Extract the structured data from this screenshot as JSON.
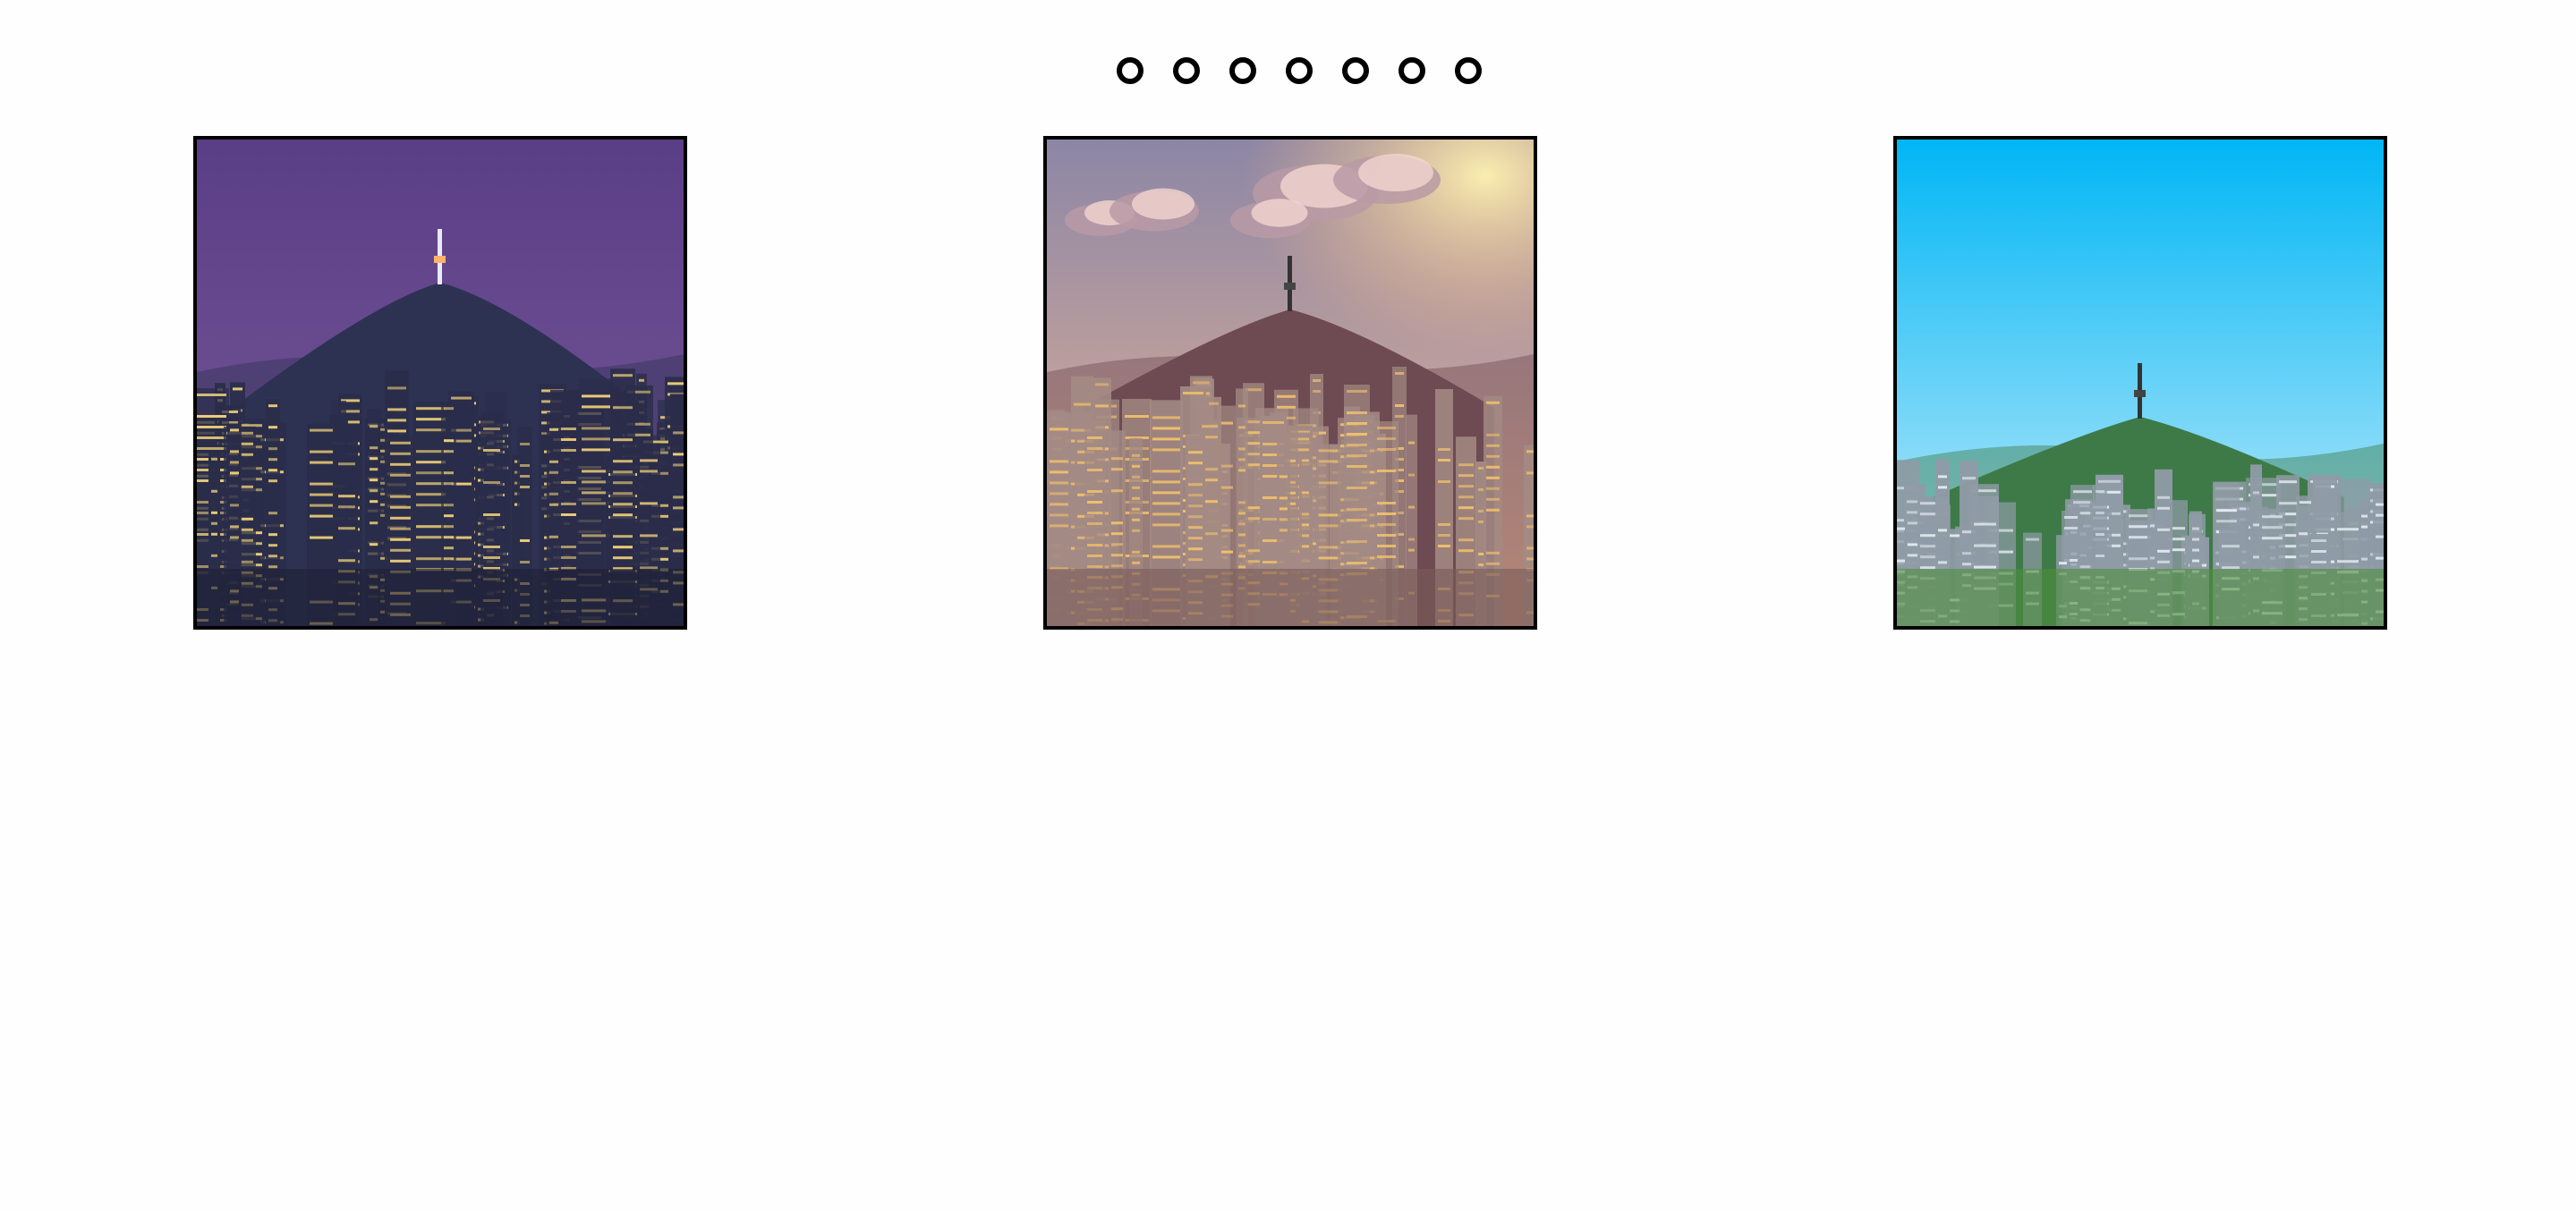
{
  "carousel": {
    "dot_count": 7,
    "slides": [
      {
        "scene": "night-city-skyline-photo",
        "sky_top": "#5a3e86",
        "sky_bottom": "#7a5a9a",
        "mountain": "#2e3252",
        "buildings": "#2a2d4a",
        "lights": "#f6d57a"
      },
      {
        "scene": "sunset-city-skyline-photo",
        "sky_top": "#8c86a6",
        "sky_bottom": "#f0b994",
        "mountain": "#6e4a52",
        "buildings": "#a38a84",
        "lights": "#f3c26a"
      },
      {
        "scene": "daytime-city-skyline-photo",
        "sky_top": "#00b6f5",
        "sky_bottom": "#cfeefa",
        "mountain": "#3e7a48",
        "buildings": "#8f9ba6",
        "lights": "#e6eef4"
      }
    ]
  }
}
